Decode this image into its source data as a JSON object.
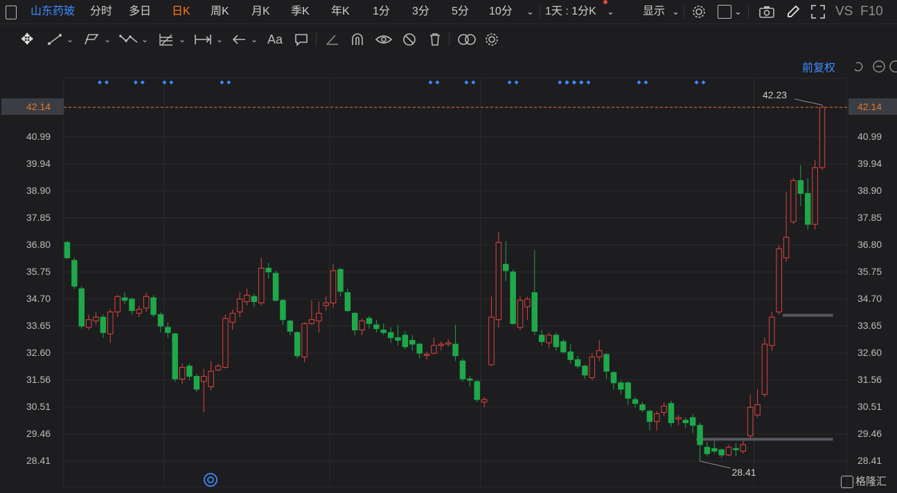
{
  "topbar": {
    "stock_name": "山东药玻",
    "periods": [
      "分时",
      "多日",
      "日K",
      "周K",
      "月K",
      "季K",
      "年K",
      "1分",
      "3分",
      "5分",
      "10分"
    ],
    "active_period": "日K",
    "interval_label": "1天 : 1分K",
    "display_label": "显示",
    "vs_label": "VS",
    "f10_label": "F10"
  },
  "toolbar": {
    "text_tool_label": "Aa"
  },
  "chart_header": {
    "adjust_label": "前复权"
  },
  "colors": {
    "up": "#e0453c",
    "down": "#1ea84a",
    "background": "#1d1d1f",
    "grid": "#2c2c30",
    "price_line": "#e8762e",
    "accent_blue": "#3d8bfd",
    "active_tab": "#ff7a1a"
  },
  "watermark": "格隆汇",
  "chart_data": {
    "type": "candlestick",
    "ylim": [
      27.5,
      43.0
    ],
    "y_ticks": [
      "42.14",
      "40.99",
      "39.94",
      "38.90",
      "37.85",
      "36.80",
      "35.75",
      "34.70",
      "33.65",
      "32.60",
      "31.56",
      "30.51",
      "29.46",
      "28.41"
    ],
    "y_tick_values": [
      42.14,
      40.99,
      39.94,
      38.9,
      37.85,
      36.8,
      35.75,
      34.7,
      33.65,
      32.6,
      31.56,
      30.51,
      29.46,
      28.41
    ],
    "current_price": "42.14",
    "max_label": "42.23",
    "min_label": "28.41",
    "candles": [
      [
        36.9,
        36.3,
        36.95,
        36.25
      ],
      [
        36.2,
        35.2,
        36.3,
        35.1
      ],
      [
        35.1,
        33.65,
        35.2,
        33.55
      ],
      [
        33.6,
        33.9,
        34.1,
        33.5
      ],
      [
        33.85,
        34.0,
        34.2,
        33.7
      ],
      [
        34.0,
        33.4,
        34.1,
        33.2
      ],
      [
        33.35,
        34.2,
        34.3,
        33.0
      ],
      [
        34.2,
        34.8,
        34.85,
        34.0
      ],
      [
        34.75,
        34.65,
        34.95,
        34.5
      ],
      [
        34.7,
        34.25,
        34.75,
        34.1
      ],
      [
        34.15,
        34.3,
        34.45,
        34.0
      ],
      [
        34.35,
        34.8,
        34.95,
        34.2
      ],
      [
        34.75,
        34.1,
        34.85,
        34.0
      ],
      [
        34.1,
        33.65,
        34.2,
        33.4
      ],
      [
        33.6,
        33.4,
        33.8,
        33.2
      ],
      [
        33.35,
        31.6,
        33.4,
        31.5
      ],
      [
        31.6,
        32.05,
        32.2,
        31.4
      ],
      [
        32.1,
        31.7,
        32.2,
        31.55
      ],
      [
        31.7,
        31.2,
        31.8,
        31.1
      ],
      [
        31.5,
        31.7,
        32.0,
        30.3
      ],
      [
        31.3,
        31.9,
        32.3,
        31.15
      ],
      [
        31.95,
        32.1,
        32.2,
        31.9
      ],
      [
        32.05,
        33.95,
        34.1,
        32.0
      ],
      [
        33.8,
        34.15,
        34.3,
        33.5
      ],
      [
        34.2,
        34.7,
        34.95,
        34.0
      ],
      [
        34.6,
        34.85,
        35.1,
        34.45
      ],
      [
        34.8,
        34.6,
        34.9,
        34.4
      ],
      [
        34.55,
        35.9,
        36.3,
        34.45
      ],
      [
        35.9,
        35.75,
        36.1,
        35.5
      ],
      [
        35.7,
        34.65,
        35.8,
        34.6
      ],
      [
        34.65,
        33.9,
        34.7,
        33.7
      ],
      [
        33.85,
        33.45,
        33.9,
        33.3
      ],
      [
        33.4,
        32.5,
        33.45,
        32.4
      ],
      [
        32.45,
        33.75,
        33.8,
        32.25
      ],
      [
        33.75,
        33.9,
        34.65,
        33.7
      ],
      [
        33.85,
        34.15,
        34.6,
        33.4
      ],
      [
        34.45,
        34.55,
        34.8,
        34.25
      ],
      [
        34.55,
        35.8,
        36.05,
        34.35
      ],
      [
        35.85,
        35.0,
        35.9,
        34.8
      ],
      [
        34.95,
        34.25,
        35.1,
        34.2
      ],
      [
        34.15,
        33.5,
        34.2,
        33.3
      ],
      [
        33.5,
        33.85,
        33.95,
        33.3
      ],
      [
        33.95,
        33.75,
        34.05,
        33.55
      ],
      [
        33.7,
        33.55,
        33.9,
        33.4
      ],
      [
        33.5,
        33.4,
        33.75,
        33.3
      ],
      [
        33.4,
        33.2,
        33.6,
        33.0
      ],
      [
        33.2,
        33.1,
        33.7,
        32.9
      ],
      [
        33.3,
        32.85,
        33.45,
        32.75
      ],
      [
        33.1,
        32.95,
        33.3,
        32.7
      ],
      [
        32.95,
        32.6,
        33.0,
        32.4
      ],
      [
        32.55,
        32.55,
        32.65,
        32.35
      ],
      [
        32.6,
        32.9,
        33.2,
        32.55
      ],
      [
        32.9,
        32.95,
        33.05,
        32.7
      ],
      [
        32.95,
        33.0,
        33.15,
        32.85
      ],
      [
        32.95,
        32.5,
        33.7,
        32.3
      ],
      [
        32.3,
        31.6,
        32.4,
        31.5
      ],
      [
        31.6,
        31.55,
        31.7,
        31.3
      ],
      [
        31.5,
        30.8,
        31.55,
        30.7
      ],
      [
        30.7,
        30.8,
        30.9,
        30.5
      ],
      [
        32.15,
        34.0,
        34.8,
        32.1
      ],
      [
        33.9,
        36.9,
        37.3,
        33.6
      ],
      [
        36.05,
        35.8,
        36.95,
        35.4
      ],
      [
        35.75,
        33.75,
        35.85,
        33.7
      ],
      [
        33.6,
        34.65,
        34.8,
        33.5
      ],
      [
        34.4,
        34.7,
        34.8,
        33.9
      ],
      [
        34.95,
        33.45,
        36.6,
        33.3
      ],
      [
        33.3,
        33.05,
        33.5,
        32.9
      ],
      [
        33.0,
        33.3,
        33.4,
        32.8
      ],
      [
        33.3,
        32.85,
        33.4,
        32.7
      ],
      [
        33.05,
        32.65,
        33.15,
        32.6
      ],
      [
        32.65,
        32.35,
        32.95,
        32.2
      ],
      [
        32.35,
        32.1,
        32.5,
        32.0
      ],
      [
        32.1,
        31.75,
        32.15,
        31.6
      ],
      [
        31.65,
        32.45,
        32.6,
        31.55
      ],
      [
        32.45,
        32.7,
        33.1,
        32.3
      ],
      [
        32.55,
        31.9,
        32.6,
        31.6
      ],
      [
        31.85,
        31.45,
        31.9,
        31.2
      ],
      [
        31.45,
        31.2,
        31.55,
        31.0
      ],
      [
        31.45,
        30.85,
        31.5,
        30.6
      ],
      [
        30.8,
        30.65,
        30.9,
        30.5
      ],
      [
        30.6,
        30.4,
        30.7,
        30.3
      ],
      [
        30.35,
        29.95,
        30.4,
        29.6
      ],
      [
        29.95,
        30.25,
        30.35,
        29.6
      ],
      [
        30.3,
        30.55,
        30.7,
        30.15
      ],
      [
        30.65,
        29.9,
        30.75,
        29.75
      ],
      [
        30.05,
        30.1,
        30.2,
        29.8
      ],
      [
        30.0,
        29.9,
        30.1,
        29.7
      ],
      [
        30.1,
        29.8,
        30.25,
        29.5
      ],
      [
        29.8,
        29.05,
        29.9,
        28.4
      ],
      [
        28.95,
        28.7,
        29.15,
        28.6
      ],
      [
        28.9,
        28.8,
        29.2,
        28.7
      ],
      [
        28.85,
        28.65,
        28.9,
        28.55
      ],
      [
        28.65,
        28.95,
        29.05,
        28.6
      ],
      [
        28.9,
        28.85,
        29.1,
        28.6
      ],
      [
        28.8,
        29.05,
        29.2,
        28.7
      ],
      [
        29.4,
        30.5,
        31.0,
        29.3
      ],
      [
        30.2,
        30.6,
        31.2,
        30.1
      ],
      [
        31.0,
        32.95,
        33.2,
        30.9
      ],
      [
        32.9,
        34.0,
        34.2,
        32.7
      ],
      [
        34.2,
        36.65,
        36.8,
        34.1
      ],
      [
        36.3,
        37.1,
        38.85,
        36.15
      ],
      [
        37.7,
        39.3,
        39.4,
        37.6
      ],
      [
        39.3,
        38.8,
        39.9,
        38.3
      ],
      [
        38.8,
        37.6,
        39.4,
        37.4
      ],
      [
        37.6,
        39.8,
        40.1,
        37.4
      ],
      [
        39.8,
        42.14,
        42.23,
        39.7
      ]
    ],
    "flat_markers": [
      {
        "price": 34.07,
        "from": 100,
        "to": 106
      },
      {
        "price": 29.26,
        "from": 88,
        "to": 106
      }
    ],
    "event_markers": [
      5,
      10,
      14,
      22,
      51,
      56,
      62,
      69,
      70,
      71,
      72,
      80,
      88
    ],
    "vertical_gridlines_at": [
      14,
      37,
      58,
      96
    ]
  }
}
